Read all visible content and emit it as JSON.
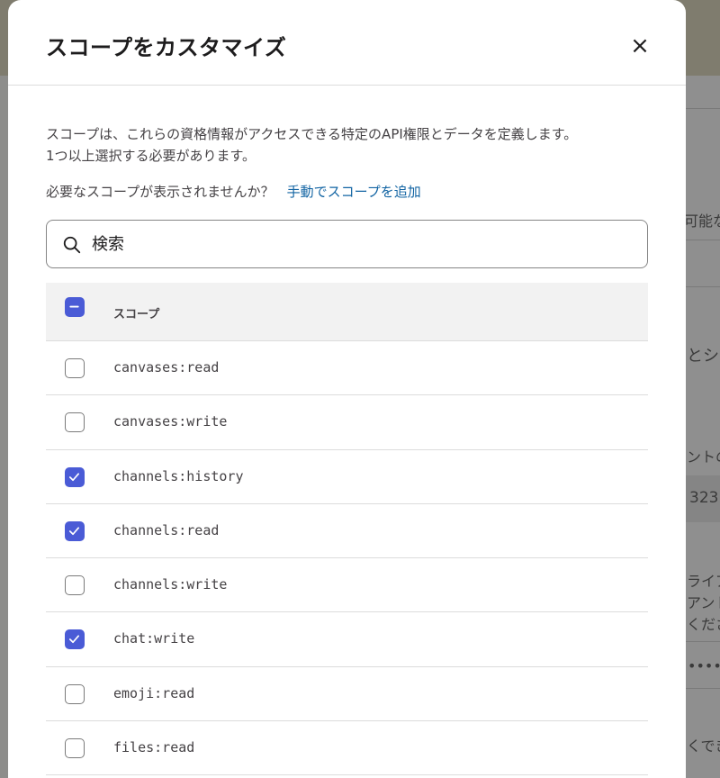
{
  "background": {
    "fragments": [
      "可能な",
      "とシ",
      "ントの",
      "323",
      "ライア",
      "アント",
      "くださ",
      "••••",
      "くでき"
    ]
  },
  "modal": {
    "title": "スコープをカスタマイズ",
    "close_label": "×",
    "description_line1": "スコープは、これらの資格情報がアクセスできる特定のAPI権限とデータを定義します。",
    "description_line2": "1つ以上選択する必要があります。",
    "missing_text": "必要なスコープが表示されませんか？",
    "add_manually_link": "手動でスコープを追加",
    "search": {
      "placeholder": "検索",
      "value": ""
    },
    "table": {
      "header": "スコープ",
      "select_all_state": "partial",
      "rows": [
        {
          "scope": "canvases:read",
          "checked": false
        },
        {
          "scope": "canvases:write",
          "checked": false
        },
        {
          "scope": "channels:history",
          "checked": true
        },
        {
          "scope": "channels:read",
          "checked": true
        },
        {
          "scope": "channels:write",
          "checked": false
        },
        {
          "scope": "chat:write",
          "checked": true
        },
        {
          "scope": "emoji:read",
          "checked": false
        },
        {
          "scope": "files:read",
          "checked": false
        }
      ]
    }
  },
  "colors": {
    "accent": "#4a5bd6",
    "link": "#1264a3",
    "overlay": "#8d8d8b"
  }
}
